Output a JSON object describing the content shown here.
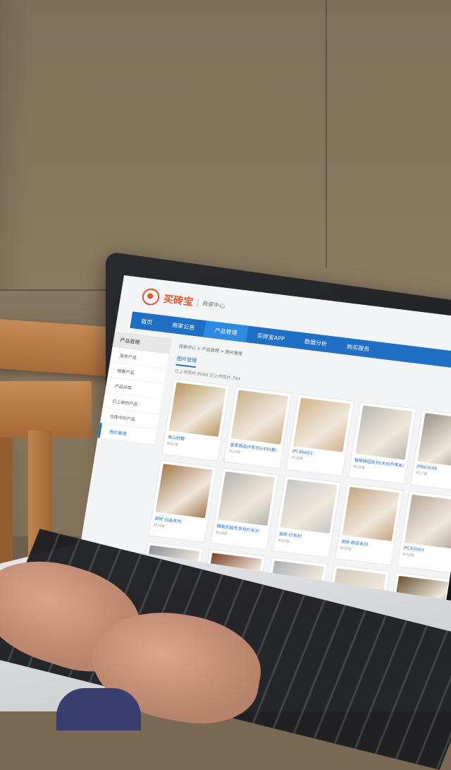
{
  "site": {
    "logo_text": "买砖宝",
    "subtitle": "商家中心"
  },
  "nav": {
    "items": [
      {
        "label": "首页",
        "active": false
      },
      {
        "label": "商家公告",
        "active": false
      },
      {
        "label": "产品管理",
        "active": true
      },
      {
        "label": "买砖宝APP",
        "active": false
      },
      {
        "label": "数据分析",
        "active": false
      },
      {
        "label": "购买服务",
        "active": false
      }
    ]
  },
  "sidebar": {
    "title": "产品管理",
    "items": [
      {
        "label": "发布产品",
        "active": false
      },
      {
        "label": "销售产品",
        "active": false
      },
      {
        "label": "产品分类",
        "active": false
      },
      {
        "label": "已上架的产品",
        "active": false
      },
      {
        "label": "仓库中的产品",
        "active": false
      },
      {
        "label": "图片管理",
        "active": true
      }
    ]
  },
  "main": {
    "breadcrumb": "商家中心 > 产品管理 > 图片管理",
    "tab_label": "图片管理",
    "stats": "已上传图片:8096   已上传图片:764",
    "cards": [
      {
        "name": "美山别墅",
        "count": "共45张",
        "color": "#b89660"
      },
      {
        "name": "皇家御品(P系列)(450套)",
        "count": "共25张",
        "color": "#c9b08a"
      },
      {
        "name": "JPC66003",
        "count": "共18张",
        "color": "#d3b38c"
      },
      {
        "name": "箱根陵园系列(木纹芦苇系列)",
        "count": "共18张",
        "color": "#bcb8b0"
      },
      {
        "name": "JPB63008",
        "count": "共17张",
        "color": "#9b9088"
      },
      {
        "name": "瓷砖·白晶系列",
        "count": "共18张",
        "color": "#a17a4e"
      },
      {
        "name": "精致花园专享特价系列",
        "count": "共18张",
        "color": "#b7b4ae"
      },
      {
        "name": "瓷砖·灯系列",
        "count": "共24张",
        "color": "#c8c6c4"
      },
      {
        "name": "瓷砖·朗廷系列",
        "count": "共28张",
        "color": "#c6a581"
      },
      {
        "name": "JPC63003",
        "count": "共26张",
        "color": "#b6a99a"
      },
      {
        "name": "",
        "count": "",
        "color": "#8c8f96"
      },
      {
        "name": "",
        "count": "",
        "color": "#7a3f28"
      },
      {
        "name": "",
        "count": "",
        "color": "#aab0b8"
      },
      {
        "name": "",
        "count": "",
        "color": "#d2c8bc"
      },
      {
        "name": "",
        "count": "",
        "color": "#6b5030"
      }
    ]
  }
}
